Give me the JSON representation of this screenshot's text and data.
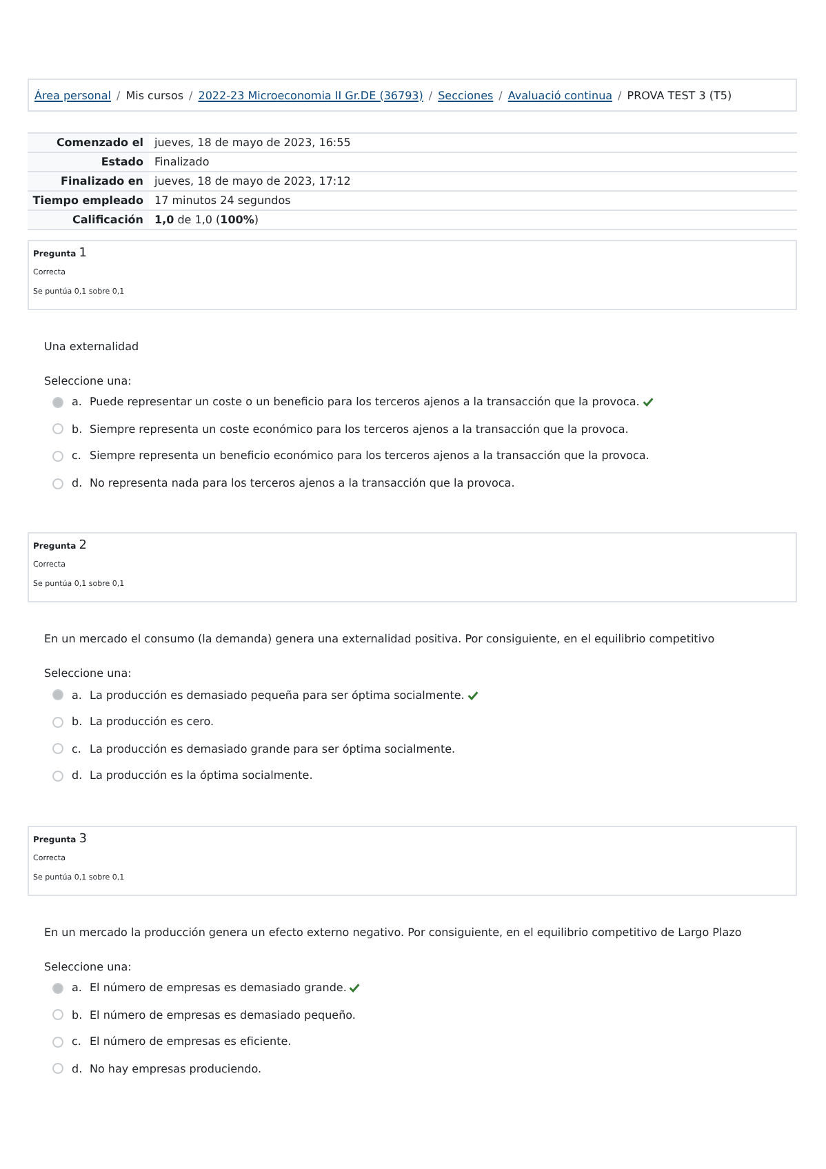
{
  "breadcrumb": [
    {
      "kind": "link",
      "label": "Área personal"
    },
    {
      "kind": "separator",
      "label": "/"
    },
    {
      "kind": "text",
      "label": "Mis cursos"
    },
    {
      "kind": "separator",
      "label": "/"
    },
    {
      "kind": "link",
      "label": "2022-23 Microeconomia II Gr.DE (36793)"
    },
    {
      "kind": "separator",
      "label": "/"
    },
    {
      "kind": "link",
      "label": "Secciones"
    },
    {
      "kind": "separator",
      "label": "/"
    },
    {
      "kind": "link",
      "label": "Avaluació continua"
    },
    {
      "kind": "separator",
      "label": "/"
    },
    {
      "kind": "text",
      "label": "PROVA TEST 3 (T5)"
    }
  ],
  "summary": [
    {
      "label": "Comenzado el",
      "value": "jueves, 18 de mayo de 2023, 16:55"
    },
    {
      "label": "Estado",
      "value": "Finalizado"
    },
    {
      "label": "Finalizado en",
      "value": "jueves, 18 de mayo de 2023, 17:12"
    },
    {
      "label": "Tiempo empleado",
      "value": "17 minutos 24 segundos"
    },
    {
      "label": "Calificación",
      "value": "**1,0** de 1,0 (**100%**)"
    }
  ],
  "questions": [
    {
      "label": "Pregunta",
      "number": "1",
      "state": "Correcta",
      "score": "Se puntúa 0,1 sobre 0,1",
      "text": "Una externalidad",
      "prompt": "Seleccione una:",
      "options": [
        {
          "letter": "a.",
          "text": "Puede representar un coste o un beneficio para los terceros ajenos a la transacción que la provoca.",
          "selected": true,
          "correct": true
        },
        {
          "letter": "b.",
          "text": "Siempre representa un coste económico para los terceros ajenos a la transacción que la provoca.",
          "selected": false,
          "correct": false
        },
        {
          "letter": "c.",
          "text": "Siempre representa un beneficio económico para los terceros ajenos a la transacción que la provoca.",
          "selected": false,
          "correct": false
        },
        {
          "letter": "d.",
          "text": "No representa nada para los terceros ajenos a la transacción que la provoca.",
          "selected": false,
          "correct": false
        }
      ]
    },
    {
      "label": "Pregunta",
      "number": "2",
      "state": "Correcta",
      "score": "Se puntúa 0,1 sobre 0,1",
      "text": "En un mercado el consumo (la demanda) genera una externalidad positiva. Por consiguiente, en el equilibrio competitivo",
      "prompt": "Seleccione una:",
      "options": [
        {
          "letter": "a.",
          "text": "La producción es demasiado pequeña para ser óptima socialmente.",
          "selected": true,
          "correct": true
        },
        {
          "letter": "b.",
          "text": "La producción es cero.",
          "selected": false,
          "correct": false
        },
        {
          "letter": "c.",
          "text": "La producción es demasiado grande para ser óptima socialmente.",
          "selected": false,
          "correct": false
        },
        {
          "letter": "d.",
          "text": "La producción es la óptima socialmente.",
          "selected": false,
          "correct": false
        }
      ]
    },
    {
      "label": "Pregunta",
      "number": "3",
      "state": "Correcta",
      "score": "Se puntúa 0,1 sobre 0,1",
      "text": "En un mercado la producción genera un efecto externo negativo. Por consiguiente, en el equilibrio competitivo de Largo Plazo",
      "prompt": "Seleccione una:",
      "options": [
        {
          "letter": "a.",
          "text": "El número de empresas es demasiado grande.",
          "selected": true,
          "correct": true
        },
        {
          "letter": "b.",
          "text": "El número de empresas es demasiado pequeño.",
          "selected": false,
          "correct": false
        },
        {
          "letter": "c.",
          "text": "El número de empresas es eficiente.",
          "selected": false,
          "correct": false
        },
        {
          "letter": "d.",
          "text": "No hay empresas produciendo.",
          "selected": false,
          "correct": false
        }
      ]
    }
  ]
}
